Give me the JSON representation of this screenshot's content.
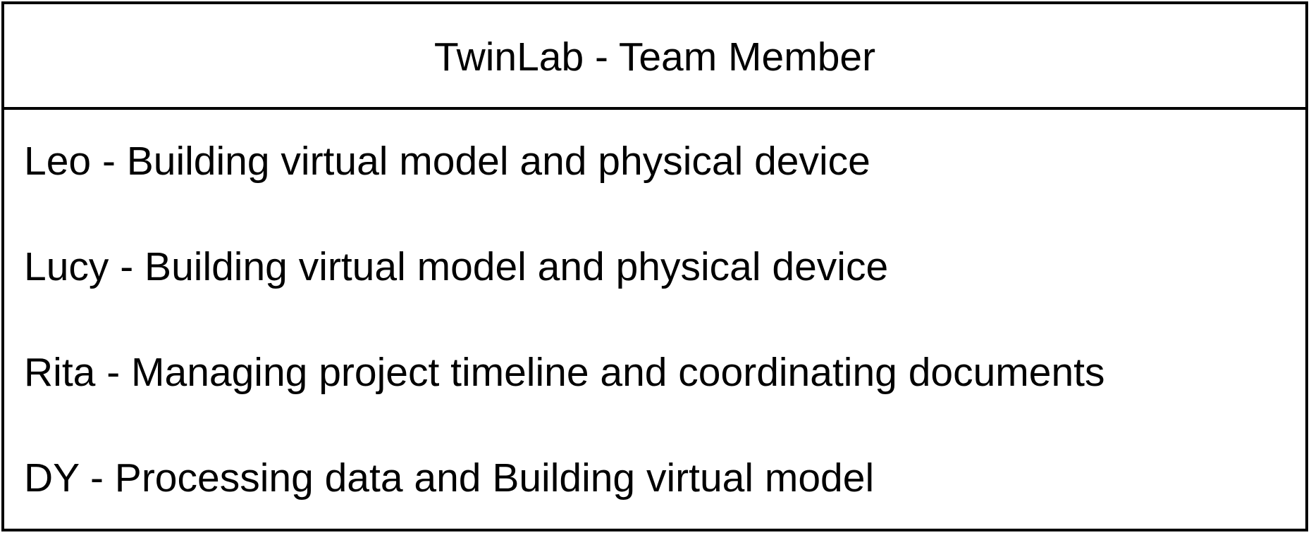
{
  "card": {
    "title": "TwinLab - Team Member",
    "members": [
      {
        "text": "Leo - Building virtual model and physical device"
      },
      {
        "text": "Lucy - Building virtual model and physical device"
      },
      {
        "text": "Rita - Managing project timeline and coordinating documents"
      },
      {
        "text": "DY - Processing data and Building virtual model"
      }
    ]
  }
}
